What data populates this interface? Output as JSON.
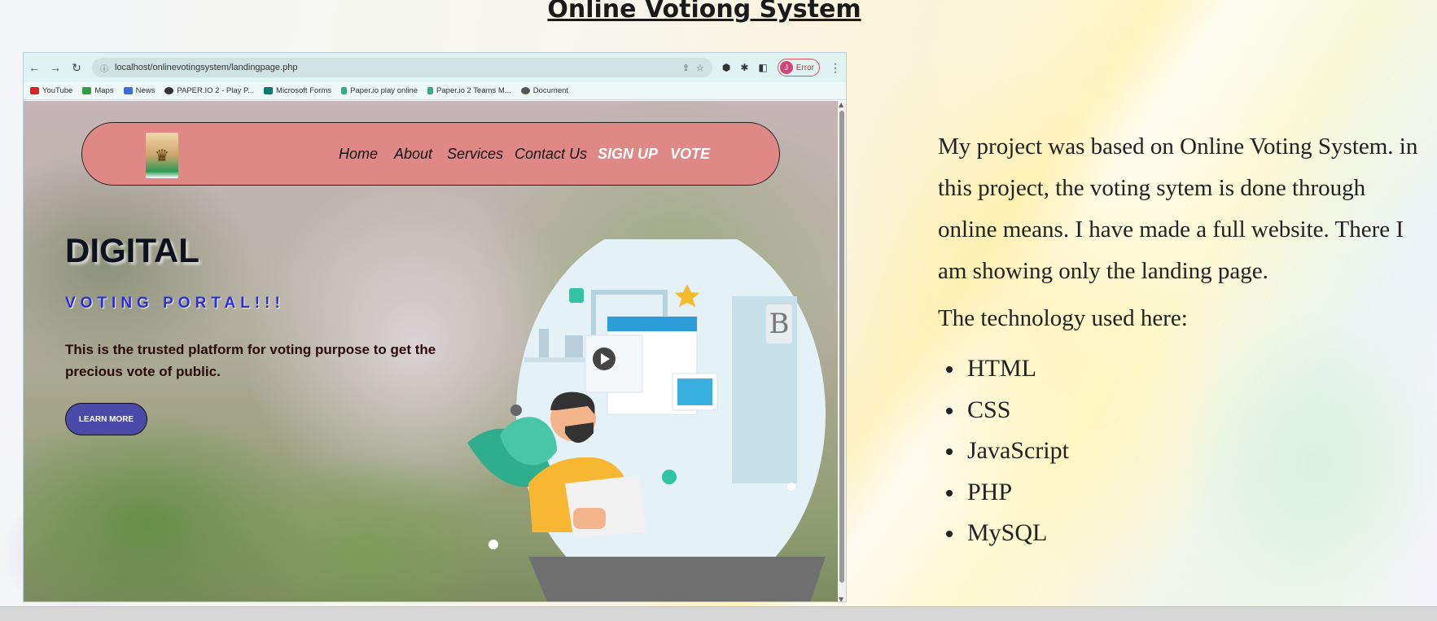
{
  "slide": {
    "title": "Online Votiong System"
  },
  "browser": {
    "url": "localhost/onlinevotingsystem/landingpage.php",
    "profile_label": "Error",
    "profile_initial": "J",
    "bookmarks": [
      {
        "label": "YouTube",
        "color": "#e02020"
      },
      {
        "label": "Maps",
        "color": "#2e9e44"
      },
      {
        "label": "News",
        "color": "#3a6fd8"
      },
      {
        "label": "PAPER.IO 2 - Play P...",
        "color": "#333333"
      },
      {
        "label": "Microsoft Forms",
        "color": "#0f7b6c"
      },
      {
        "label": "Paper.io play online",
        "color": "#2fae8e"
      },
      {
        "label": "Paper.io 2 Teams M...",
        "color": "#2fae8e"
      },
      {
        "label": "Document",
        "color": "#555555"
      }
    ]
  },
  "site": {
    "nav": {
      "home": "Home",
      "about": "About",
      "services": "Services",
      "contact": "Contact Us",
      "signup": "SIGN UP",
      "vote": "VOTE"
    },
    "hero": {
      "title": "DIGITAL",
      "subtitle": "VOTING PORTAL!!!",
      "description": "This is the trusted platform for voting purpose to get the precious vote of public.",
      "button": "LEARN MORE"
    },
    "watermark": "B"
  },
  "notes": {
    "paragraph": "My project was based on Online Voting System. in this project, the voting sytem is done through online means. I have made a full website. There I am showing only the landing page.",
    "tech_heading": "The technology used here:",
    "technologies": [
      "HTML",
      "CSS",
      "JavaScript",
      "PHP",
      "MySQL"
    ]
  },
  "colors": {
    "navbar_bg": "#e08886",
    "subtitle_blue": "#2a2ae8",
    "button_bg": "#4a4aa8"
  }
}
